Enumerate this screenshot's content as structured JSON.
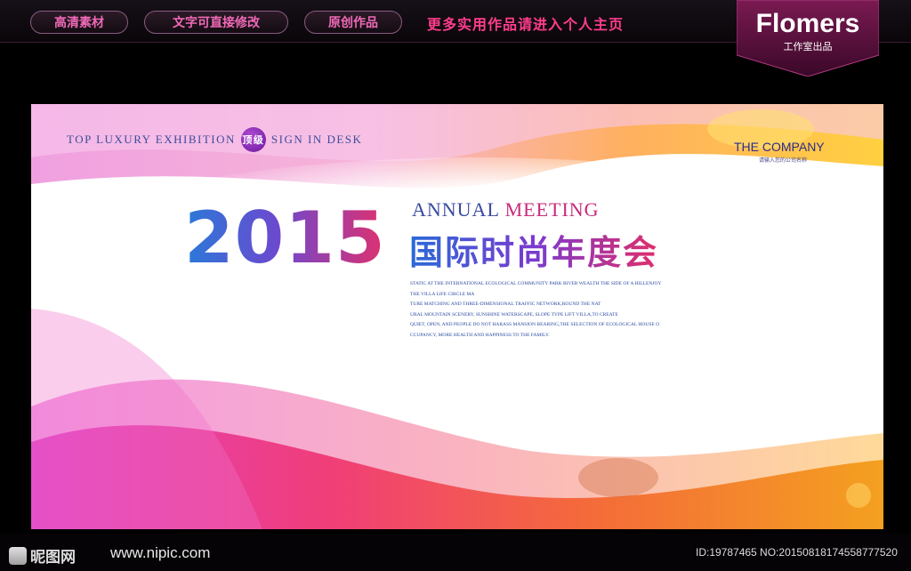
{
  "topbar": {
    "tags": [
      "高清素材",
      "文字可直接修改",
      "原创作品"
    ],
    "promo": "更多实用作品请进入个人主页"
  },
  "brand": {
    "name": "Flomers",
    "sub": "工作室出品"
  },
  "banner": {
    "top_left": "TOP LUXURY EXHIBITION",
    "badge": "顶级",
    "top_right": "SIGN IN DESK",
    "company": "THE COMPANY",
    "company_sub": "请输入您的公司名称",
    "year": "2015",
    "annual": "ANNUAL",
    "meeting": "MEETING",
    "cn_title": "国际时尚年度会",
    "desc_lines": [
      "STATIC AT THE INTERNATIONAL ECOLOGICAL COMMUNITY PARK RIVER WEALTH THE SIDE OF A HILLENJOY",
      "THE VILLA LIFE CIRCLE MA",
      "TURE MATCHING AND THREE-DIMENSIONAL TRAFFIC NETWORK,ROUND THE NAT",
      "URAL MOUNTAIN SCENERY, SUNSHINE WATERSCAPE, SLOPE TYPE LIFT VILLA,TO CREATE",
      "QUIET, OPEN, AND PEOPLE DO NOT HARASS MANSION BEARING,THE SELECTION OF ECOLOGICAL HOUSE O",
      "CCUPANCY, MORE HEALTH AND HAPPINESS TO THE FAMILY."
    ]
  },
  "footer": {
    "logo": "昵图网",
    "site": "www.nipic.com",
    "ids": "ID:19787465 NO:20150818174558777520"
  },
  "colors": {
    "accent_pink": "#ff3d8c",
    "title_blue": "#2a6ad8",
    "title_red": "#e02e6a"
  }
}
